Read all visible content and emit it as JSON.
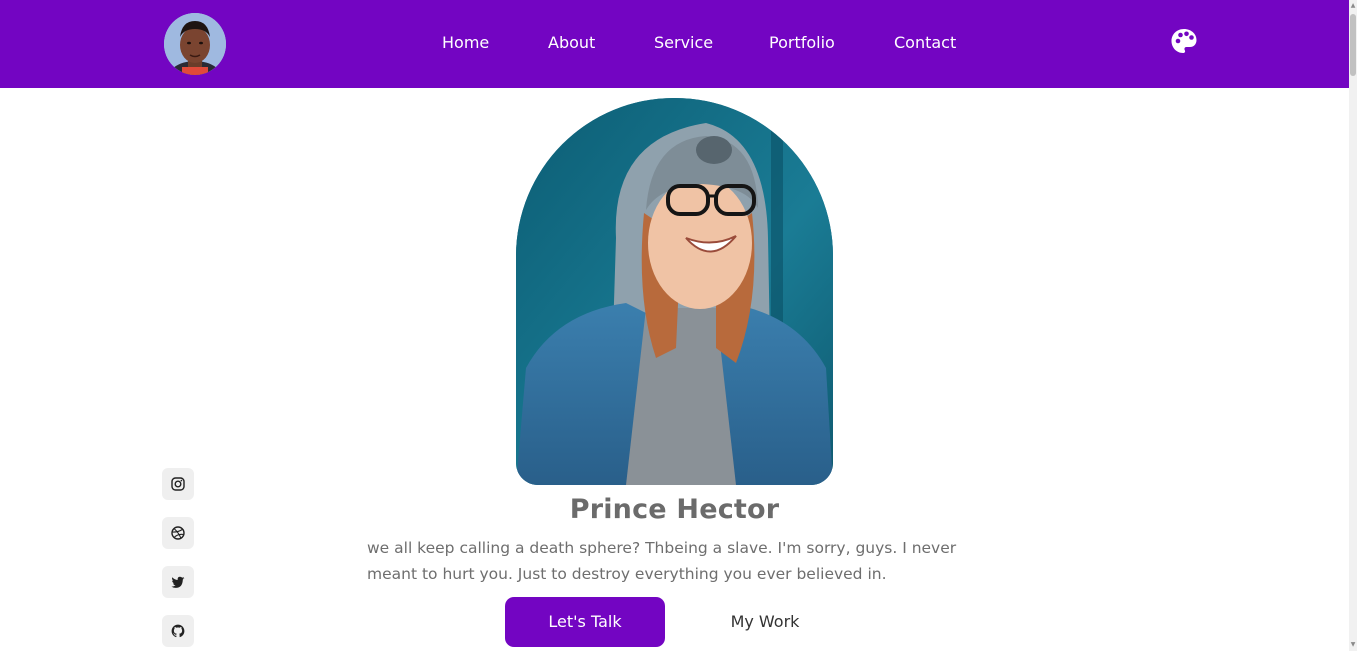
{
  "nav": {
    "links": [
      "Home",
      "About",
      "Service",
      "Portfolio",
      "Contact"
    ]
  },
  "hero": {
    "name": "Prince Hector",
    "description": "we all keep calling a death sphere? Thbeing a slave. I'm sorry, guys. I never meant to hurt you. Just to destroy everything you ever believed in.",
    "primary_button": "Let's Talk",
    "secondary_button": "My Work"
  },
  "social": {
    "icons": [
      "instagram-icon",
      "dribbble-icon",
      "twitter-icon",
      "github-icon"
    ]
  },
  "colors": {
    "brand": "#7305c2",
    "text_muted": "#6e6e6e",
    "social_bg": "#efefef"
  }
}
